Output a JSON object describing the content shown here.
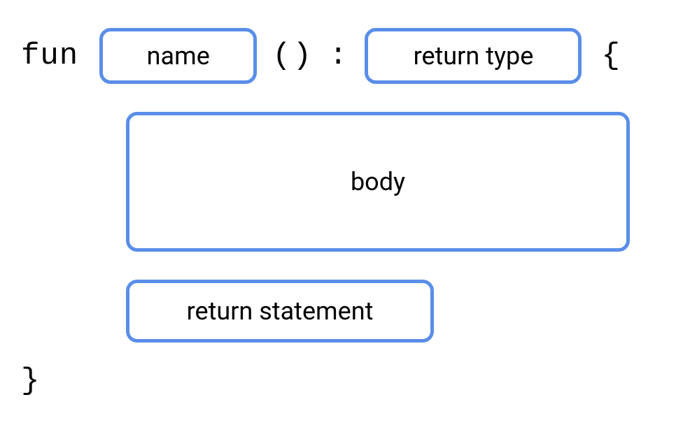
{
  "syntax": {
    "keyword": "fun",
    "parens": "()",
    "colon": ":",
    "open_brace": "{",
    "close_brace": "}"
  },
  "placeholders": {
    "name": "name",
    "return_type": "return type",
    "body": "body",
    "return_statement": "return statement"
  }
}
